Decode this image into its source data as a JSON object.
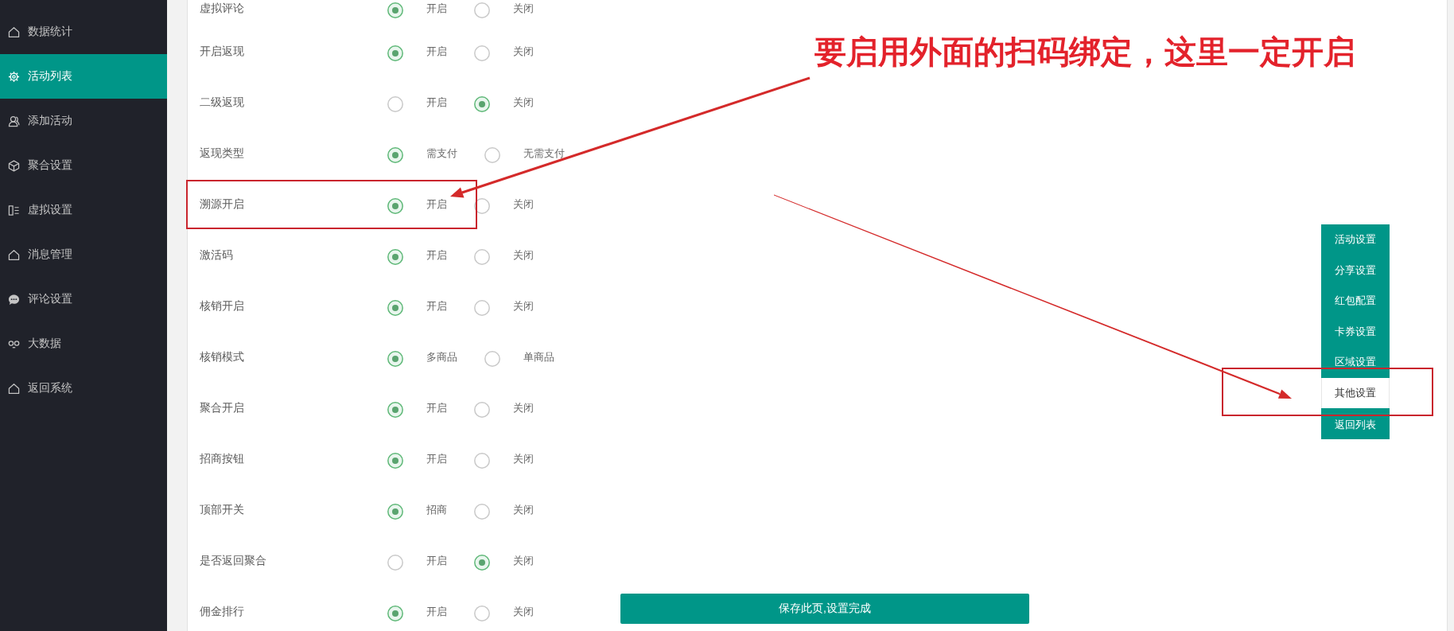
{
  "sidebar": {
    "items": [
      {
        "label": "数据统计",
        "selected": false
      },
      {
        "label": "活动列表",
        "selected": true
      },
      {
        "label": "添加活动",
        "selected": false
      },
      {
        "label": "聚合设置",
        "selected": false
      },
      {
        "label": "虚拟设置",
        "selected": false
      },
      {
        "label": "消息管理",
        "selected": false
      },
      {
        "label": "评论设置",
        "selected": false
      },
      {
        "label": "大数据",
        "selected": false
      },
      {
        "label": "返回系统",
        "selected": false
      }
    ]
  },
  "form": {
    "rows": [
      {
        "label": "虚拟评论",
        "options": [
          {
            "label": "开启",
            "selected": true
          },
          {
            "label": "关闭",
            "selected": false
          }
        ]
      },
      {
        "label": "开启返现",
        "options": [
          {
            "label": "开启",
            "selected": true
          },
          {
            "label": "关闭",
            "selected": false
          }
        ]
      },
      {
        "label": "二级返现",
        "options": [
          {
            "label": "开启",
            "selected": false
          },
          {
            "label": "关闭",
            "selected": true
          }
        ]
      },
      {
        "label": "返现类型",
        "options": [
          {
            "label": "需支付",
            "selected": true
          },
          {
            "label": "无需支付",
            "selected": false
          }
        ]
      },
      {
        "label": "溯源开启",
        "options": [
          {
            "label": "开启",
            "selected": true
          },
          {
            "label": "关闭",
            "selected": false
          }
        ]
      },
      {
        "label": "激活码",
        "options": [
          {
            "label": "开启",
            "selected": true
          },
          {
            "label": "关闭",
            "selected": false
          }
        ]
      },
      {
        "label": "核销开启",
        "options": [
          {
            "label": "开启",
            "selected": true
          },
          {
            "label": "关闭",
            "selected": false
          }
        ]
      },
      {
        "label": "核销模式",
        "options": [
          {
            "label": "多商品",
            "selected": true
          },
          {
            "label": "单商品",
            "selected": false
          }
        ]
      },
      {
        "label": "聚合开启",
        "options": [
          {
            "label": "开启",
            "selected": true
          },
          {
            "label": "关闭",
            "selected": false
          }
        ]
      },
      {
        "label": "招商按钮",
        "options": [
          {
            "label": "开启",
            "selected": true
          },
          {
            "label": "关闭",
            "selected": false
          }
        ]
      },
      {
        "label": "顶部开关",
        "options": [
          {
            "label": "招商",
            "selected": true
          },
          {
            "label": "关闭",
            "selected": false
          }
        ]
      },
      {
        "label": "是否返回聚合",
        "options": [
          {
            "label": "开启",
            "selected": false
          },
          {
            "label": "关闭",
            "selected": true
          }
        ]
      },
      {
        "label": "佣金排行",
        "options": [
          {
            "label": "开启",
            "selected": true
          },
          {
            "label": "关闭",
            "selected": false
          }
        ]
      }
    ]
  },
  "save_button": {
    "label": "保存此页,设置完成"
  },
  "section_nav": {
    "items": [
      {
        "label": "活动设置",
        "selected": false
      },
      {
        "label": "分享设置",
        "selected": false
      },
      {
        "label": "红包配置",
        "selected": false
      },
      {
        "label": "卡券设置",
        "selected": false
      },
      {
        "label": "区域设置",
        "selected": false
      },
      {
        "label": "其他设置",
        "selected": true
      },
      {
        "label": "返回列表",
        "selected": false
      }
    ]
  },
  "annotation": {
    "text": "要启用外面的扫码绑定，这里一定开启"
  }
}
